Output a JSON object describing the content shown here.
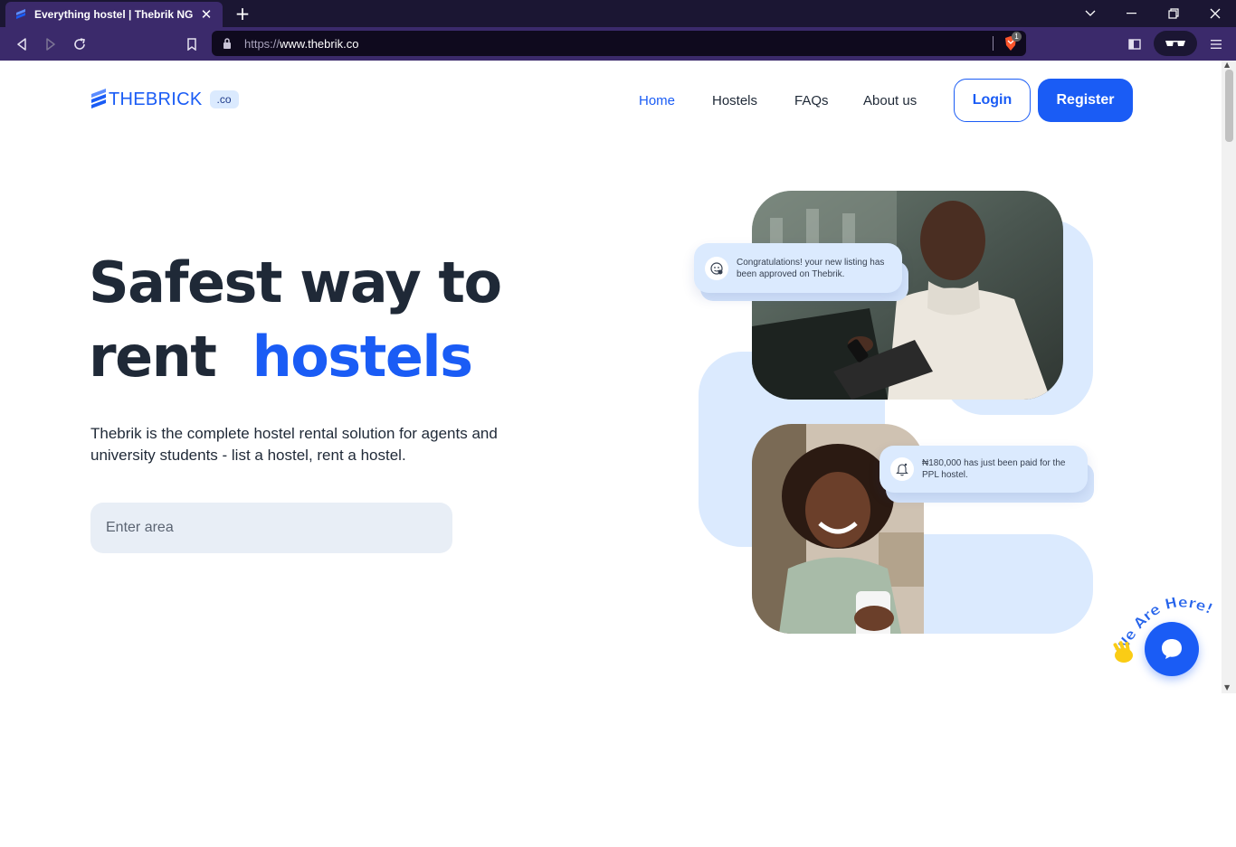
{
  "browser": {
    "tab_title": "Everything hostel | Thebrik NG",
    "tab_close": "✕",
    "new_tab": "+",
    "url_protocol": "https://",
    "url_host": "www.thebrik.co",
    "shield_count": "1",
    "window_controls": [
      "chevron-down-icon",
      "minimize-icon",
      "restore-icon",
      "close-icon"
    ]
  },
  "header": {
    "logo_text": "THEBRICK",
    "logo_suffix": ".co",
    "nav": [
      "Home",
      "Hostels",
      "FAQs",
      "About us"
    ],
    "active_nav": "Home",
    "login_label": "Login",
    "register_label": "Register"
  },
  "hero": {
    "title_line1": "Safest way to",
    "title_line2": "rent",
    "title_accent": "hostels",
    "subtitle": "Thebrik is the complete hostel rental solution for agents and university students - list a hostel, rent a hostel.",
    "search_placeholder": "Enter area"
  },
  "notifications": [
    {
      "text": "Congratulations! your new listing has been approved on Thebrik.",
      "icon": "approved-icon"
    },
    {
      "text": "₦180,000 has just been paid for the PPL hostel.",
      "icon": "bell-icon"
    }
  ],
  "chat_widget": {
    "badge_text": "We Are Here!",
    "icon": "chat-bubble-icon"
  },
  "colors": {
    "brand": "#1a5cf5",
    "light_blue": "#dbeafe",
    "text_dark": "#1f2937",
    "chrome_dark": "#1b1633",
    "chrome_toolbar": "#3b2a6b"
  }
}
